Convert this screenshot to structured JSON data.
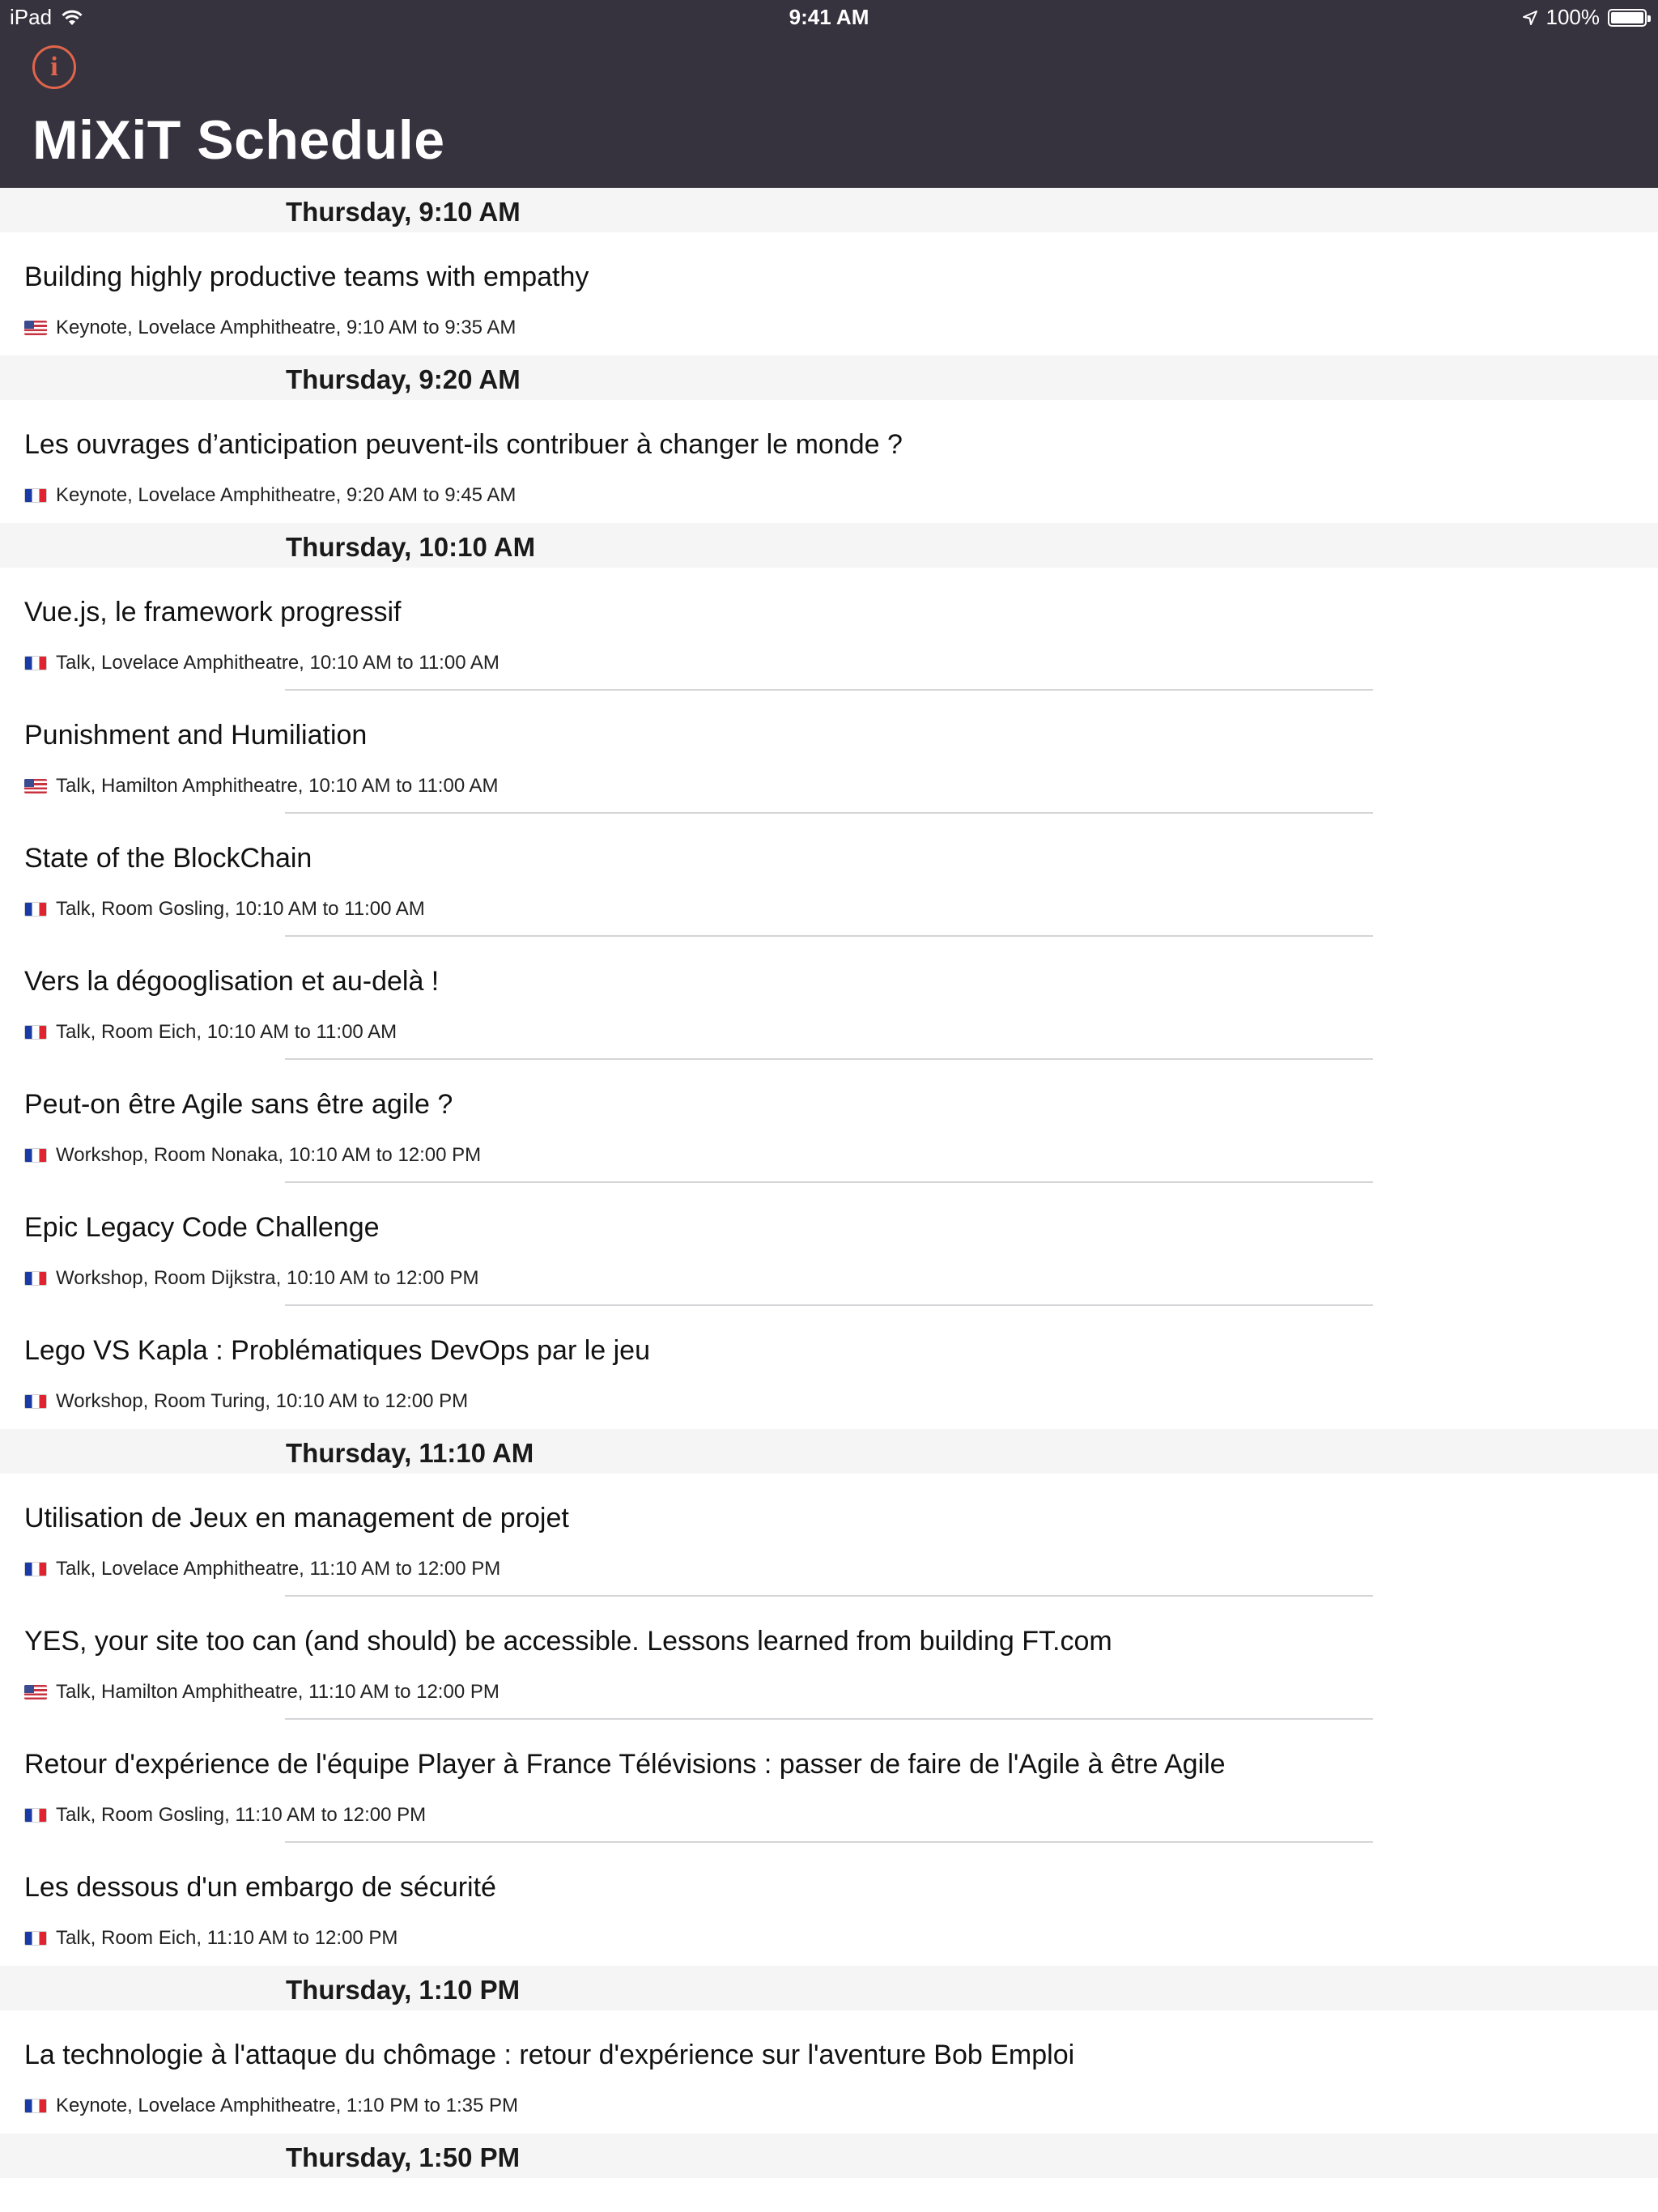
{
  "status_bar": {
    "device": "iPad",
    "time": "9:41 AM",
    "battery": "100%"
  },
  "header": {
    "info_icon_glyph": "i",
    "title": "MiXiT Schedule"
  },
  "colors": {
    "header_bg": "#36333f",
    "accent": "#e0654a",
    "section_bg": "#f5f5f5"
  },
  "sections": [
    {
      "title": "Thursday, 9:10 AM",
      "sessions": [
        {
          "title": "Building highly productive teams with empathy",
          "flag": "us",
          "meta": "Keynote, Lovelace Amphitheatre, 9:10 AM to 9:35 AM"
        }
      ]
    },
    {
      "title": "Thursday, 9:20 AM",
      "sessions": [
        {
          "title": "Les ouvrages d’anticipation peuvent-ils contribuer à changer le monde ?",
          "flag": "fr",
          "meta": "Keynote, Lovelace Amphitheatre, 9:20 AM to 9:45 AM"
        }
      ]
    },
    {
      "title": "Thursday, 10:10 AM",
      "sessions": [
        {
          "title": "Vue.js, le framework progressif",
          "flag": "fr",
          "meta": "Talk, Lovelace Amphitheatre, 10:10 AM to 11:00 AM"
        },
        {
          "title": "Punishment and Humiliation",
          "flag": "us",
          "meta": "Talk, Hamilton Amphitheatre, 10:10 AM to 11:00 AM"
        },
        {
          "title": "State of the BlockChain",
          "flag": "fr",
          "meta": "Talk, Room Gosling, 10:10 AM to 11:00 AM"
        },
        {
          "title": "Vers la dégooglisation et au-delà !",
          "flag": "fr",
          "meta": "Talk, Room Eich, 10:10 AM to 11:00 AM"
        },
        {
          "title": "Peut-on être Agile sans être agile ?",
          "flag": "fr",
          "meta": "Workshop, Room Nonaka, 10:10 AM to 12:00 PM"
        },
        {
          "title": "Epic Legacy Code Challenge",
          "flag": "fr",
          "meta": "Workshop, Room Dijkstra, 10:10 AM to 12:00 PM"
        },
        {
          "title": "Lego VS Kapla : Problématiques DevOps par le jeu",
          "flag": "fr",
          "meta": "Workshop, Room Turing, 10:10 AM to 12:00 PM"
        }
      ]
    },
    {
      "title": "Thursday, 11:10 AM",
      "sessions": [
        {
          "title": "Utilisation de Jeux en management de projet",
          "flag": "fr",
          "meta": "Talk, Lovelace Amphitheatre, 11:10 AM to 12:00 PM"
        },
        {
          "title": "YES, your site too can (and should) be accessible. Lessons learned from building FT.com",
          "flag": "us",
          "meta": "Talk, Hamilton Amphitheatre, 11:10 AM to 12:00 PM"
        },
        {
          "title": "Retour d'expérience de l'équipe Player à France Télévisions : passer de faire de l'Agile à être Agile",
          "flag": "fr",
          "meta": "Talk, Room Gosling, 11:10 AM to 12:00 PM"
        },
        {
          "title": "Les dessous d'un embargo de sécurité",
          "flag": "fr",
          "meta": "Talk, Room Eich, 11:10 AM to 12:00 PM"
        }
      ]
    },
    {
      "title": "Thursday, 1:10 PM",
      "sessions": [
        {
          "title": "La technologie à l'attaque du chômage : retour d'expérience sur l'aventure Bob Emploi",
          "flag": "fr",
          "meta": "Keynote, Lovelace Amphitheatre, 1:10 PM to 1:35 PM"
        }
      ]
    },
    {
      "title": "Thursday, 1:50 PM",
      "sessions": []
    }
  ]
}
